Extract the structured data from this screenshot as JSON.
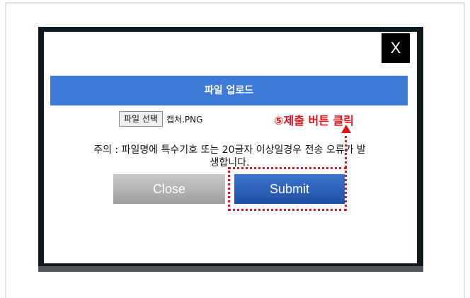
{
  "modal": {
    "close_x_label": "X",
    "title": "파일 업로드",
    "file_button_label": "파일 선택",
    "file_name": "캡처.PNG",
    "warning_line1": "주의 : 파일명에 특수기호 또는 20글자 이상일경우 전송 오류가 발",
    "warning_line2": "생합니다.",
    "close_button_label": "Close",
    "submit_button_label": "Submit"
  },
  "annotation": {
    "label": "⑤제출 버튼 클릭",
    "color": "#e0141a"
  },
  "colors": {
    "title_bar": "#3d79d6",
    "submit_button": "#2a5db7",
    "close_button": "#b0b0b0"
  }
}
